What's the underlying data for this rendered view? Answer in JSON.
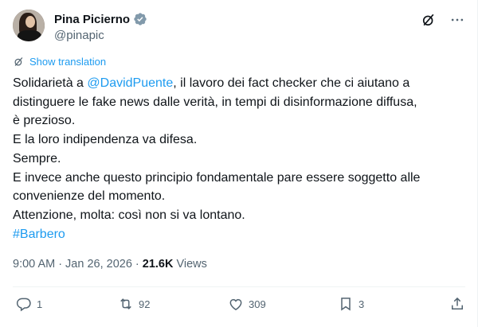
{
  "author": {
    "display_name": "Pina Picierno",
    "handle": "@pinapic"
  },
  "translation_label": "Show translation",
  "tweet": {
    "lines": [
      {
        "pre": "Solidarietà a ",
        "link": "@DavidPuente",
        "post": ", il lavoro dei fact checker che ci aiutano a"
      },
      {
        "text": "distinguere le fake news dalle verità, in tempi di disinformazione diffusa,"
      },
      {
        "text": "è prezioso."
      },
      {
        "text": "E la loro indipendenza va difesa."
      },
      {
        "text": "Sempre."
      },
      {
        "text": "E invece anche questo principio fondamentale pare essere soggetto alle"
      },
      {
        "text": "convenienze del momento."
      },
      {
        "text": "Attenzione, molta: così non si va lontano."
      }
    ],
    "hashtag": "#Barbero"
  },
  "meta": {
    "time": "9:00 AM",
    "separator": "·",
    "date": "Jan 26, 2026",
    "views_count": "21.6K",
    "views_label": "Views"
  },
  "actions": {
    "replies": "1",
    "reposts": "92",
    "likes": "309",
    "bookmarks": "3"
  },
  "colors": {
    "accent": "#1d9bf0",
    "muted": "#536471",
    "verified_badge": "#829aab"
  },
  "icons": [
    "verified-badge-icon",
    "grok-icon",
    "more-icon",
    "translate-icon",
    "reply-icon",
    "repost-icon",
    "like-icon",
    "bookmark-icon",
    "share-icon"
  ]
}
